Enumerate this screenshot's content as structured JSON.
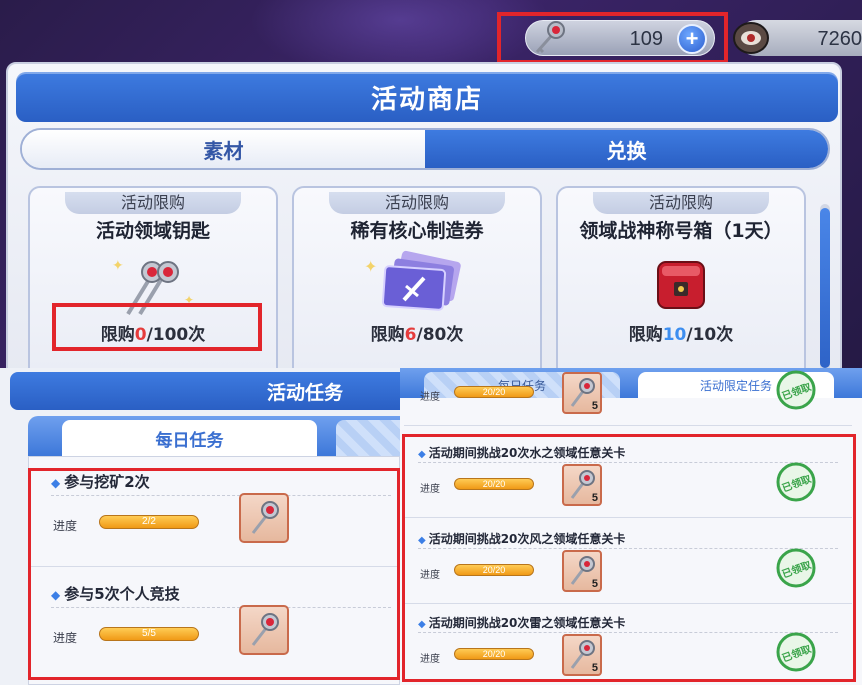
{
  "currency": {
    "key_value": "109",
    "plus_label": "+",
    "core_value": "7260"
  },
  "shop": {
    "title": "活动商店",
    "tabs": [
      {
        "label": "素材",
        "active": false
      },
      {
        "label": "兑换",
        "active": true
      }
    ],
    "items": [
      {
        "badge": "活动限购",
        "name": "活动领域钥匙",
        "limit_prefix": "限购",
        "limit_used": "0",
        "limit_total": "/100次",
        "icon": "key-icon"
      },
      {
        "badge": "活动限购",
        "name": "稀有核心制造券",
        "limit_prefix": "限购",
        "limit_used": "6",
        "limit_total": "/80次",
        "icon": "ticket-icon"
      },
      {
        "badge": "活动限购",
        "name": "领域战神称号箱（1天）",
        "limit_prefix": "限购",
        "limit_used": "10",
        "limit_total": "/10次",
        "icon": "box-icon"
      }
    ]
  },
  "tasks_left": {
    "title": "活动任务",
    "tab_daily": "每日任务",
    "items": [
      {
        "title": "参与挖矿2次",
        "progress_label": "进度",
        "progress": "2/2"
      },
      {
        "title": "参与5次个人竞技",
        "progress_label": "进度",
        "progress": "5/5"
      }
    ]
  },
  "tasks_right": {
    "tab_daily": "每日任务",
    "tab_limited": "活动限定任务",
    "items": [
      {
        "title": "",
        "progress_label": "进度",
        "progress": "20/20",
        "reward_count": "5"
      },
      {
        "title": "活动期间挑战20次水之领域任意关卡",
        "progress_label": "进度",
        "progress": "20/20",
        "reward_count": "5"
      },
      {
        "title": "活动期间挑战20次风之领域任意关卡",
        "progress_label": "进度",
        "progress": "20/20",
        "reward_count": "5"
      },
      {
        "title": "活动期间挑战20次雷之领域任意关卡",
        "progress_label": "进度",
        "progress": "20/20",
        "reward_count": "5"
      }
    ],
    "claimed_label": "已领取"
  }
}
